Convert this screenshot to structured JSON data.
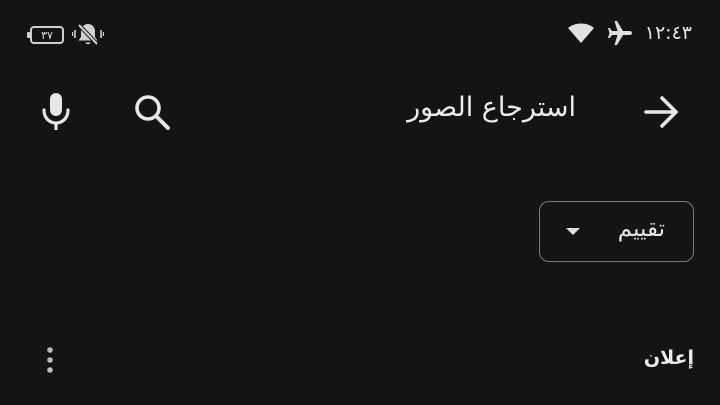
{
  "status_bar": {
    "time": "١٢:٤٣",
    "battery_level": "٣٧",
    "icons": [
      "wifi-icon",
      "airplane-icon",
      "battery-icon",
      "vibrate-off-icon"
    ]
  },
  "search": {
    "query": "استرجاع الصور",
    "icons": [
      "forward-arrow-icon",
      "search-icon",
      "mic-icon"
    ]
  },
  "filter": {
    "sort_label": "تقييم"
  },
  "ad": {
    "label": "إعلان",
    "menu_icon": "more-vert-icon"
  },
  "colors": {
    "background": "#141414",
    "text": "#e6e6e6",
    "border": "#7a7a7a"
  }
}
